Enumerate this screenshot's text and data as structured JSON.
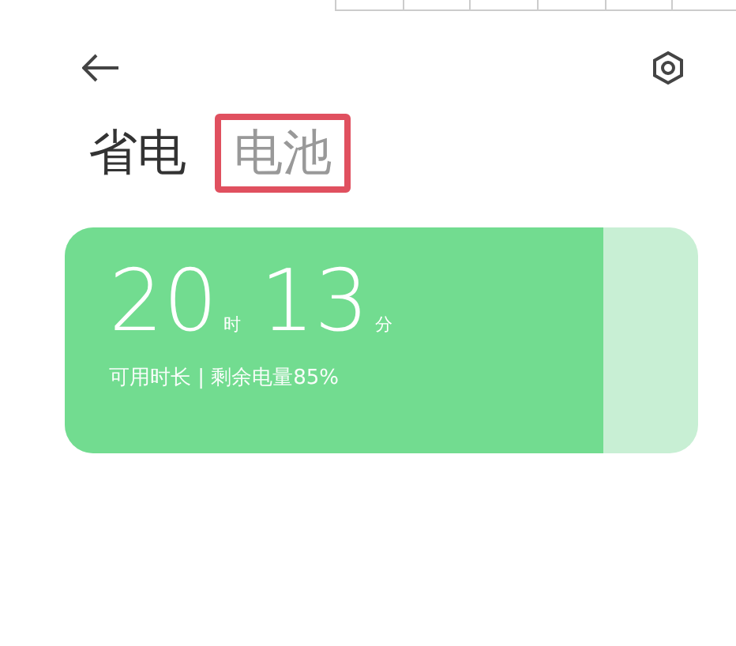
{
  "tabs": [
    {
      "label": "省电",
      "selected": true,
      "highlighted": false
    },
    {
      "label": "电池",
      "selected": false,
      "highlighted": true
    }
  ],
  "battery_card": {
    "level": 0.85,
    "hours": "20",
    "hours_unit": "时",
    "minutes": "13",
    "minutes_unit": "分",
    "caption": "可用时长 | 剩余电量85%"
  }
}
